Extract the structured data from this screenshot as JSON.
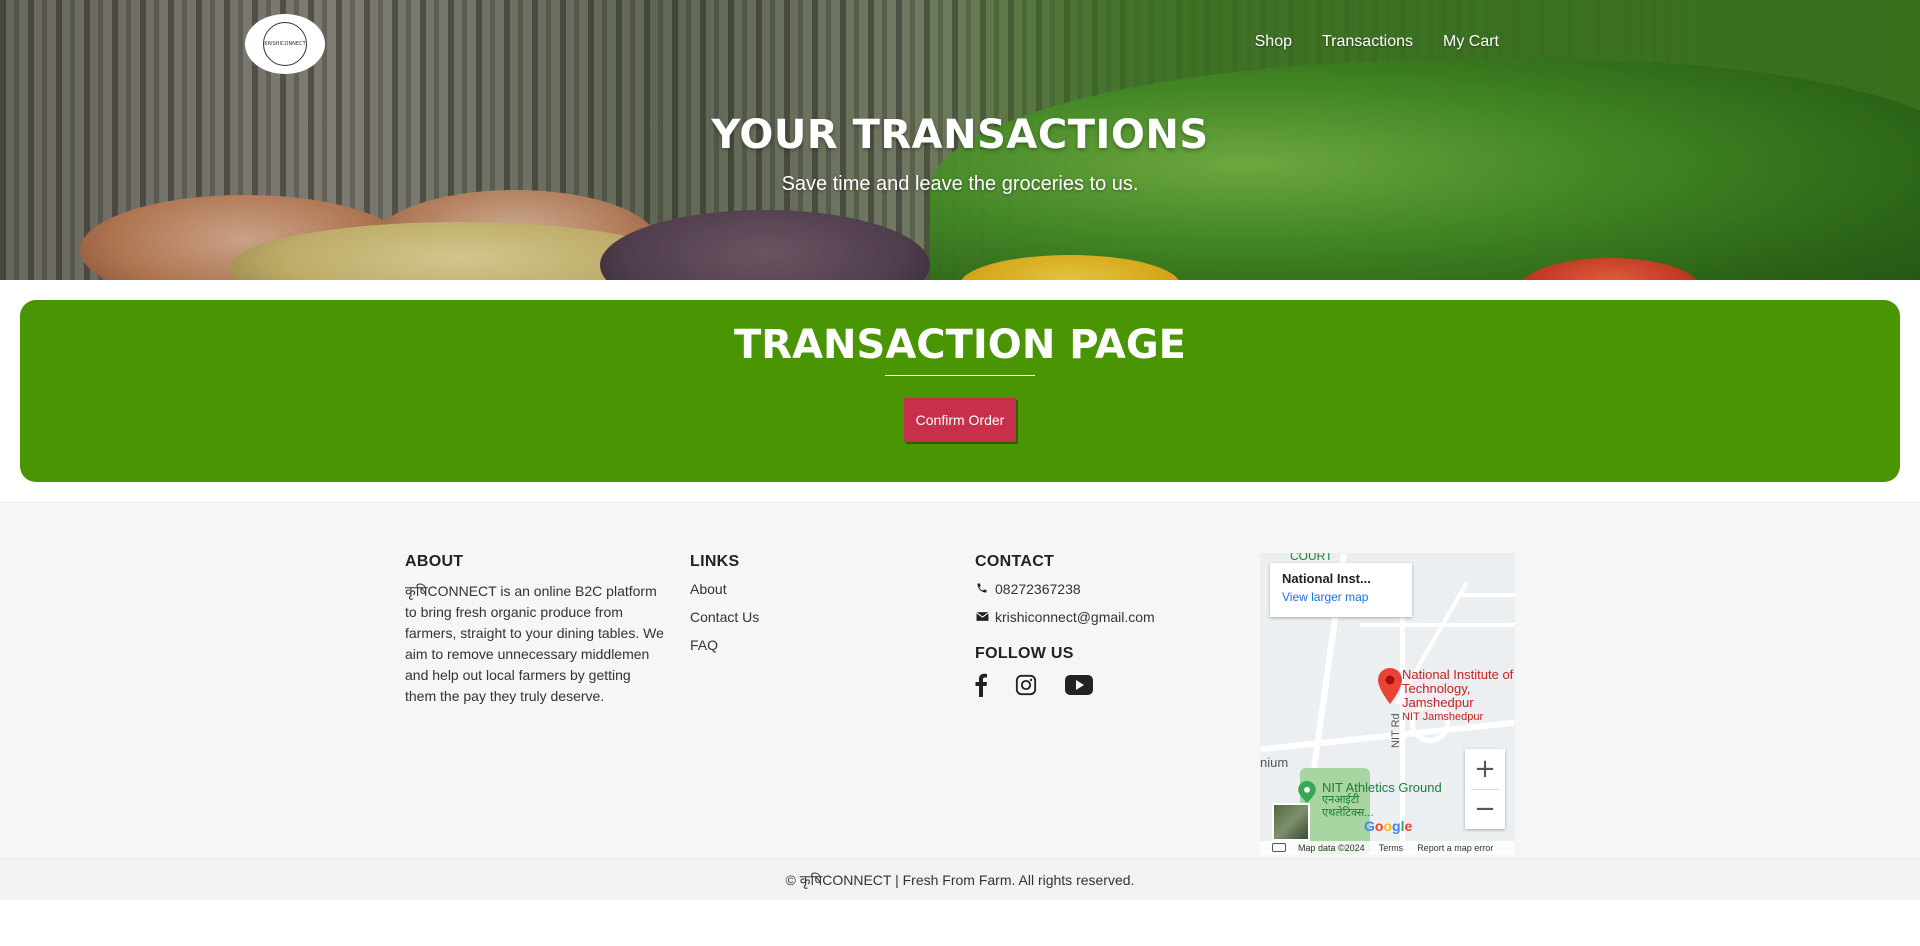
{
  "header": {
    "logo_alt": "KRISHICONNECT",
    "nav": [
      {
        "label": "Shop"
      },
      {
        "label": "Transactions"
      },
      {
        "label": "My Cart"
      }
    ]
  },
  "hero": {
    "title": "YOUR TRANSACTIONS",
    "subtitle": "Save time and leave the groceries to us."
  },
  "panel": {
    "title": "TRANSACTION PAGE",
    "confirm_label": "Confirm Order",
    "bg_color": "#4a9504",
    "button_color": "#c6304a"
  },
  "footer": {
    "about": {
      "heading": "ABOUT",
      "text": "कृषिCONNECT is an online B2C platform to bring fresh organic produce from farmers, straight to your dining tables. We aim to remove unnecessary middlemen and help out local farmers by getting them the pay they truly deserve."
    },
    "links": {
      "heading": "LINKS",
      "items": [
        "About",
        "Contact Us",
        "FAQ"
      ]
    },
    "contact": {
      "heading": "CONTACT",
      "phone": "08272367238",
      "email": "krishiconnect@gmail.com",
      "follow_heading": "FOLLOW US",
      "social_icons": [
        "facebook-icon",
        "instagram-icon",
        "youtube-icon"
      ]
    },
    "map": {
      "place_name": "National Inst...",
      "view_larger": "View larger map",
      "pin_label_1": "National Institute of",
      "pin_label_2": "Technology, Jamshedpur",
      "pin_sub": "NIT Jamshedpur",
      "athletics_1": "NIT Athletics Ground",
      "athletics_2": "एनआईटी",
      "athletics_3": "एथलेटिक्स...",
      "road_label": "NIT Rd",
      "partial_label": "nium",
      "court_label": "COURT",
      "zoom_in": "+",
      "zoom_out": "−",
      "attribution": [
        "Map data ©2024",
        "Terms",
        "Report a map error"
      ]
    },
    "copyright": "© कृषिCONNECT | Fresh From Farm. All rights reserved."
  }
}
